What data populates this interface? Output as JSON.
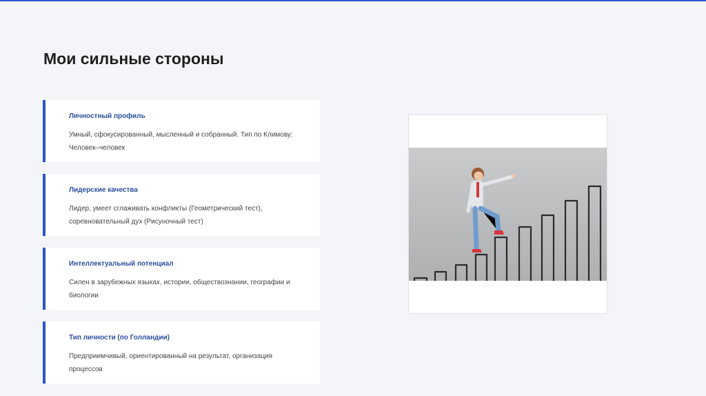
{
  "slide": {
    "title": "Мои сильные стороны"
  },
  "cards": [
    {
      "title": "Личностный профиль",
      "text": "Умный, сфокусированный, мысленный и собранный. Тип по Климову: Человек–человек"
    },
    {
      "title": "Лидерские качества",
      "text": "Лидер, умеет сглаживать конфликты (Геометрический тест), соревновательный дух (Рисуночный тест)"
    },
    {
      "title": "Интеллектуальный потенциал",
      "text": "Силен в зарубежных языках, истории, обществознании, географии и биологии"
    },
    {
      "title": "Тип личности (по Голландии)",
      "text": "Предприимчивый, ориентированный на результат, организация процессов"
    }
  ],
  "colors": {
    "accent": "#2a54c9",
    "card_title": "#2a4f9e",
    "background": "#f4f5f9"
  }
}
